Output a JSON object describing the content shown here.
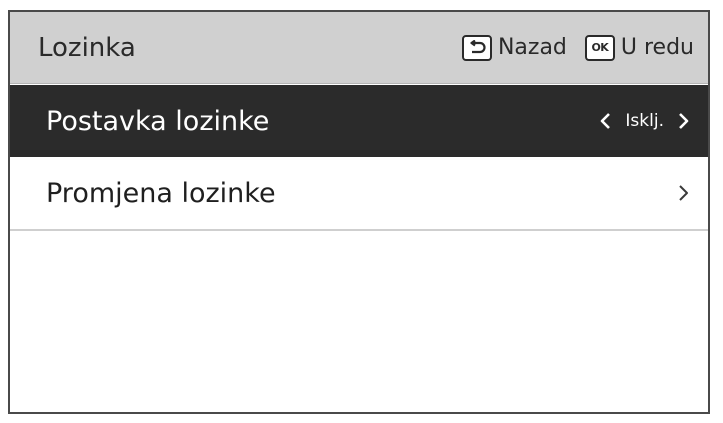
{
  "header": {
    "title": "Lozinka",
    "back_label": "Nazad",
    "ok_label": "U redu",
    "ok_key_text": "OK"
  },
  "menu": {
    "items": [
      {
        "label": "Postavka lozinke",
        "value": "Isklj.",
        "selected": true
      },
      {
        "label": "Promjena lozinke",
        "selected": false
      }
    ]
  },
  "icons": {
    "back": "back-arrow-icon",
    "ok": "ok-key-icon",
    "left": "chevron-left-icon",
    "right": "chevron-right-icon"
  },
  "colors": {
    "header_bg": "#d0d0d0",
    "selected_bg": "#2b2b2b",
    "selected_text": "#ffffff",
    "text": "#2a2a2a"
  }
}
